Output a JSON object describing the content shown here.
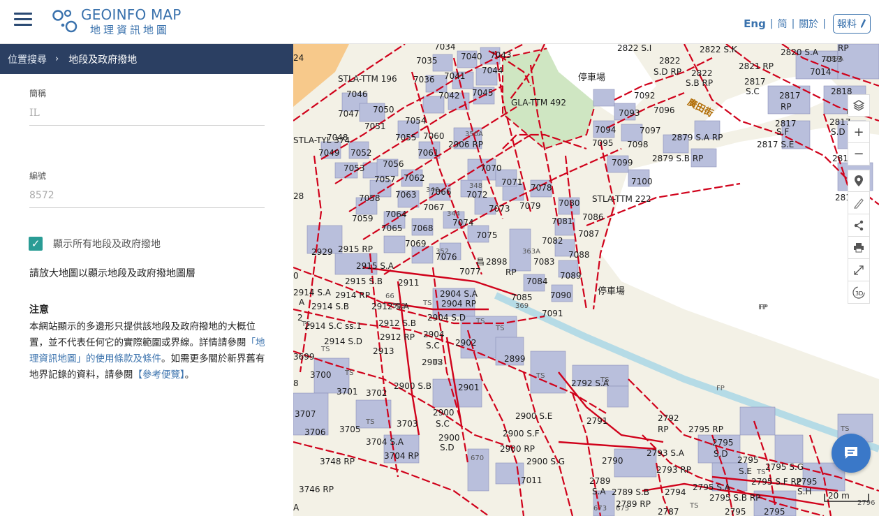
{
  "header": {
    "logo_title": "GEOINFO MAP",
    "logo_subtitle": "地理資訊地圖",
    "nav": {
      "english": "Eng",
      "simplified": "简",
      "about": "關於",
      "report": "報料"
    }
  },
  "breadcrumb": {
    "parent": "位置搜尋",
    "separator": "›",
    "current": "地段及政府撥地"
  },
  "form": {
    "abbr_label": "簡稱",
    "abbr_value": "IL",
    "number_label": "編號",
    "number_value": "8572",
    "show_all_label": "顯示所有地段及政府撥地",
    "show_all_checked": true
  },
  "hint": "請放大地圖以顯示地段及政府撥地圖層",
  "notice": {
    "title": "注意",
    "text_1": "本網站顯示的多邊形只提供該地段及政府撥地的大概位置，並不代表任何它的實際範圍或界線。詳情請參閱",
    "link_terms": "「地理資訊地圖」的使用條款及條件",
    "text_2": "。如需更多關於新界舊有地界記錄的資料，請參閱",
    "link_ref": "【參考便覽】",
    "text_3": "。"
  },
  "map": {
    "scale_label": "20 m",
    "corner_label": "2796",
    "labels": {
      "parking_1": "停車場",
      "parking_2": "停車場",
      "street": "廣田街",
      "glaname": "GLA-TTM 492",
      "stla196": "STLA-TTM 196",
      "stla222": "STLA-TTM 222",
      "stlatyl": "STLA-TYL 374",
      "fp": "FP"
    }
  },
  "colors": {
    "accent": "#3a72ad",
    "breadcrumb_bg": "#2b3f62",
    "check": "#2a9c95",
    "lot_line": "#d0021b",
    "building": "#b9bfdc",
    "map_bg": "#f3f1e6"
  },
  "icons": {
    "menu": "hamburger-icon",
    "layers": "layers-icon",
    "zoom_in": "plus-icon",
    "zoom_out": "minus-icon",
    "location": "location-pin-icon",
    "measure": "pencil-icon",
    "share": "share-icon",
    "print": "printer-icon",
    "fullscreen": "expand-icon",
    "three_d": "3d-icon",
    "chat": "chat-icon"
  }
}
